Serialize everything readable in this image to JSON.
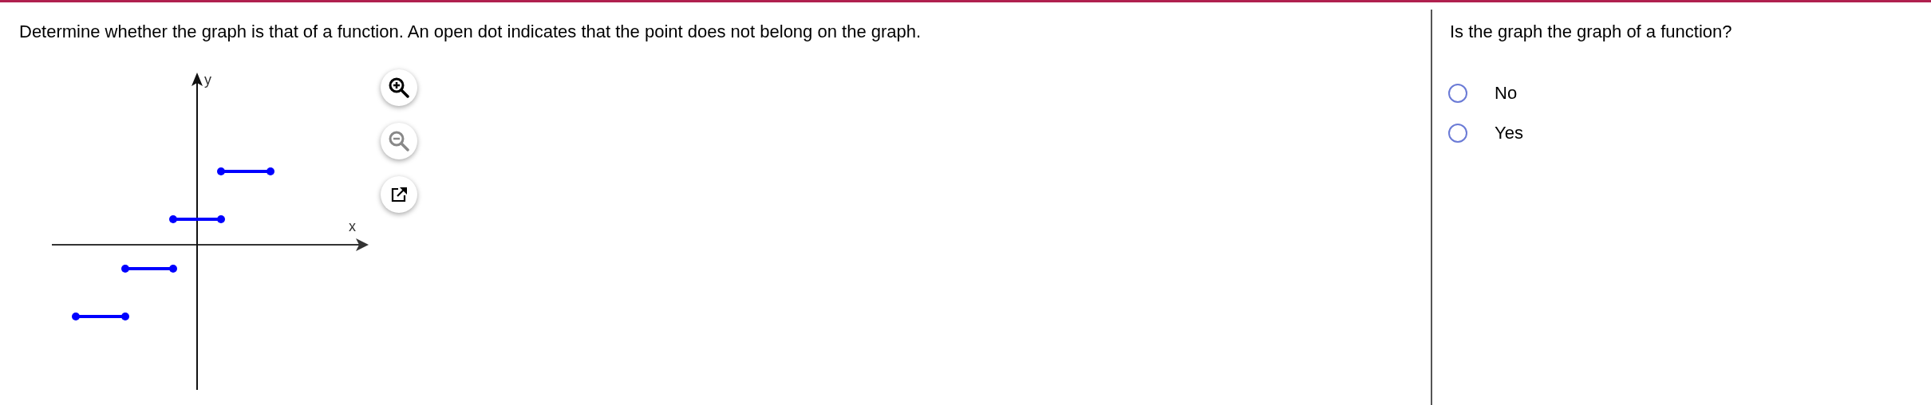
{
  "instructions": "Determine whether the graph is that of a function. An open dot indicates that the point does not belong on the graph.",
  "graph": {
    "x_label": "x",
    "y_label": "y"
  },
  "question": "Is the graph the graph of a function?",
  "options": [
    {
      "label": "No",
      "selected": false
    },
    {
      "label": "Yes",
      "selected": false
    }
  ]
}
